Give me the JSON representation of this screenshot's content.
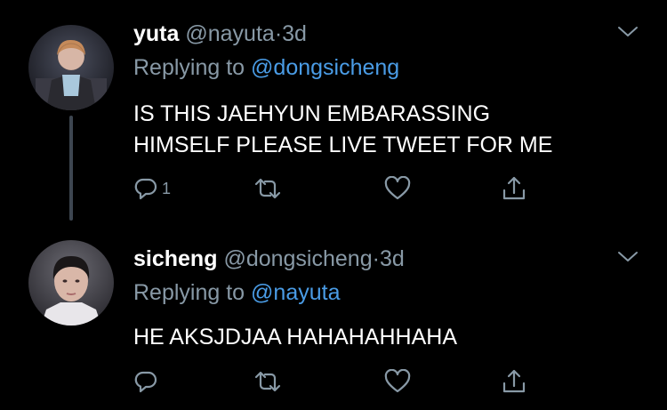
{
  "colors": {
    "background": "#000000",
    "secondary_text": "#8899a6",
    "mention": "#4a9ce6",
    "thread_line": "#3d4650"
  },
  "tweets": [
    {
      "display_name": "yuta",
      "handle": "@nayuta",
      "separator": "·",
      "time": "3d",
      "replying_prefix": "Replying to",
      "replying_to": "@dongsicheng",
      "text_lines": [
        "IS THIS JAEHYUN EMBARASSING",
        "HIMSELF PLEASE LIVE TWEET FOR ME"
      ],
      "reply_count": "1",
      "icons": {
        "reply": "reply-icon",
        "retweet": "retweet-icon",
        "like": "heart-icon",
        "share": "share-icon",
        "menu": "chevron-down-icon"
      }
    },
    {
      "display_name": "sicheng",
      "handle": "@dongsicheng",
      "separator": "·",
      "time": "3d",
      "replying_prefix": "Replying to",
      "replying_to": "@nayuta",
      "text_lines": [
        "HE AKSJDJAA HAHAHAHHAHA"
      ],
      "reply_count": "",
      "icons": {
        "reply": "reply-icon",
        "retweet": "retweet-icon",
        "like": "heart-icon",
        "share": "share-icon",
        "menu": "chevron-down-icon"
      }
    }
  ]
}
